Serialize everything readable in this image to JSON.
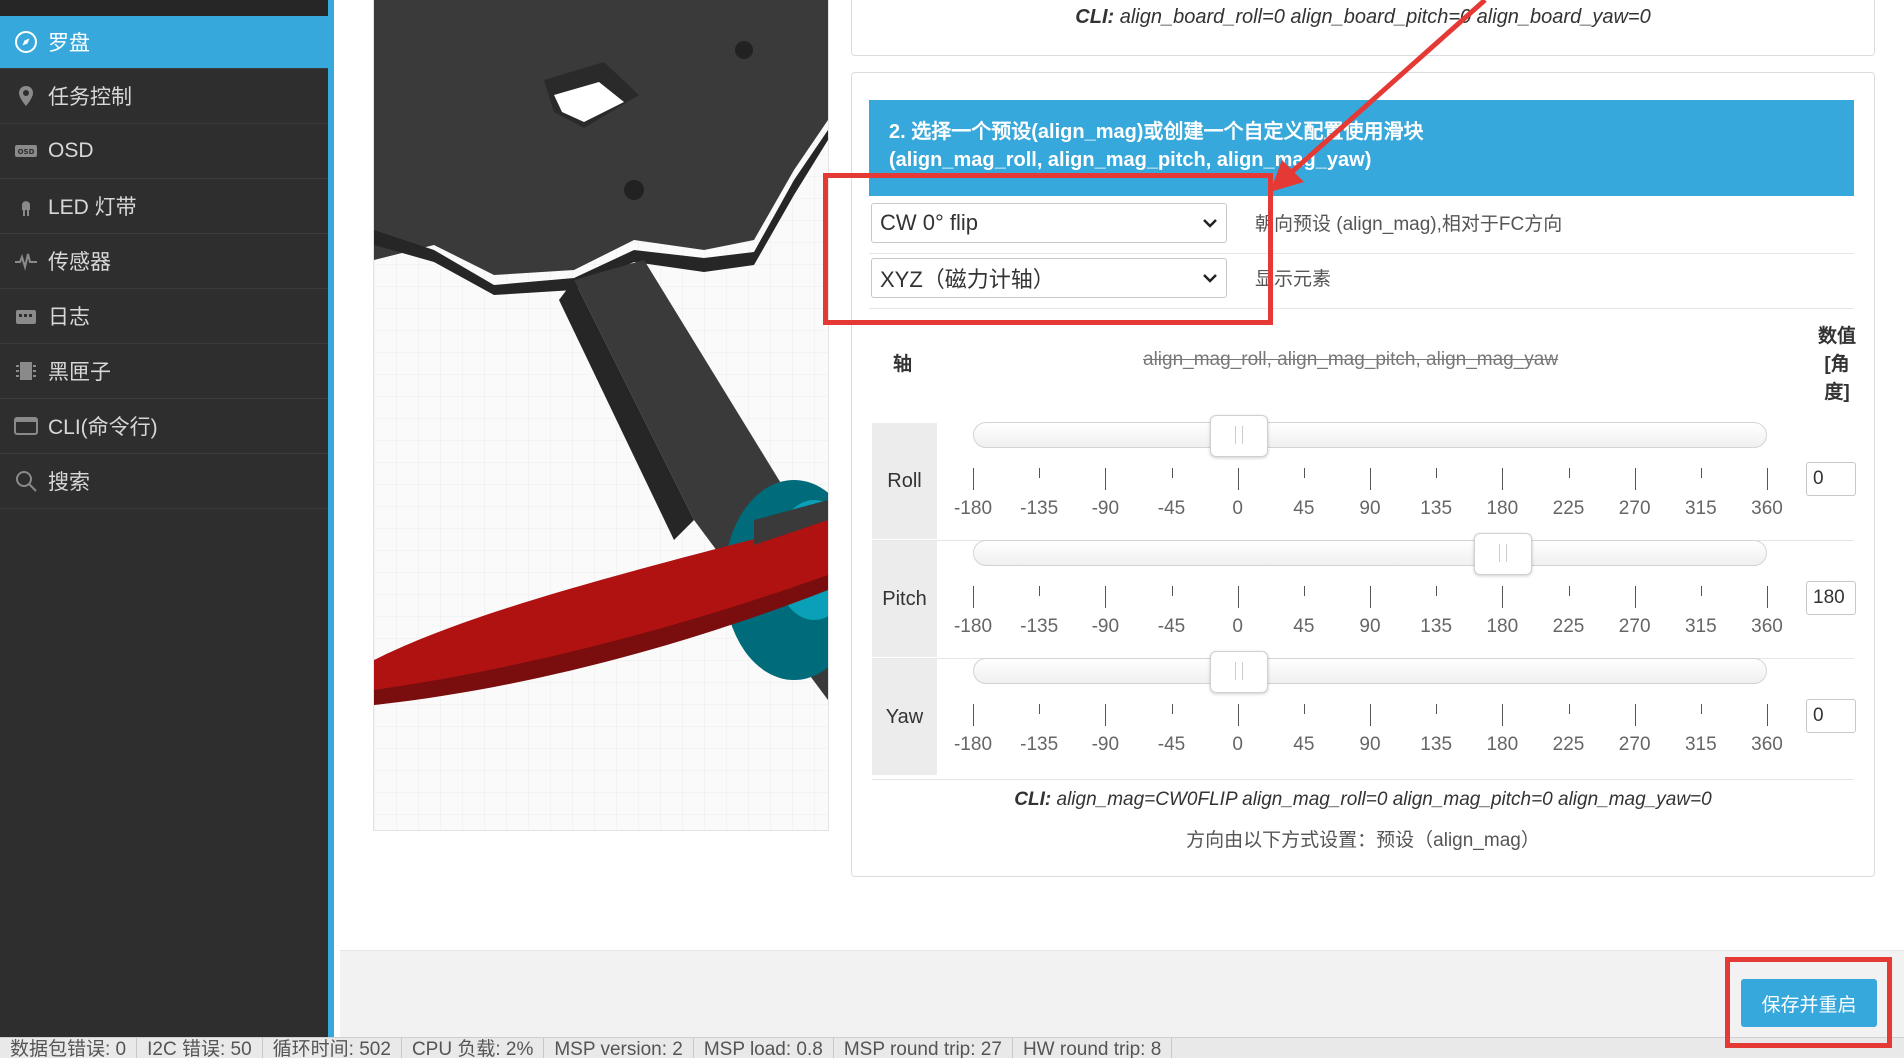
{
  "sidebar": {
    "items": [
      {
        "label": "罗盘",
        "icon": "compass-icon",
        "active": true
      },
      {
        "label": "任务控制",
        "icon": "map-pin-icon"
      },
      {
        "label": "OSD",
        "icon": "osd-icon"
      },
      {
        "label": "LED 灯带",
        "icon": "led-icon"
      },
      {
        "label": "传感器",
        "icon": "sensor-wave-icon"
      },
      {
        "label": "日志",
        "icon": "log-icon"
      },
      {
        "label": "黑匣子",
        "icon": "blackbox-icon"
      },
      {
        "label": "CLI(命令行)",
        "icon": "terminal-icon"
      },
      {
        "label": "搜索",
        "icon": "search-icon"
      }
    ]
  },
  "board": {
    "cli_prefix": "CLI:",
    "cli_text": "align_board_roll=0 align_board_pitch=0 align_board_yaw=0"
  },
  "mag": {
    "header_line1": "2. 选择一个预设(align_mag)或创建一个自定义配置使用滑块",
    "header_line2": "(align_mag_roll, align_mag_pitch, align_mag_yaw)",
    "preset_value": "CW 0° flip",
    "preset_label": "朝向预设 (align_mag),相对于FC方向",
    "display_value": "XYZ（磁力计轴）",
    "display_label": "显示元素",
    "axis_header": "轴",
    "params_header": "align_mag_roll, align_mag_pitch, align_mag_yaw",
    "value_header_1": "数值",
    "value_header_2": "[角",
    "value_header_3": "度]",
    "ticks": [
      "-180",
      "-135",
      "-90",
      "-45",
      "0",
      "45",
      "90",
      "135",
      "180",
      "225",
      "270",
      "315",
      "360"
    ],
    "axes": [
      {
        "name": "Roll",
        "value": "0",
        "level": 0
      },
      {
        "name": "Pitch",
        "value": "180",
        "level": 180
      },
      {
        "name": "Yaw",
        "value": "0",
        "level": 0
      }
    ],
    "slider_min": -180,
    "slider_max": 360,
    "cli_prefix": "CLI:",
    "cli_text": "align_mag=CW0FLIP align_mag_roll=0 align_mag_pitch=0 align_mag_yaw=0",
    "note": "方向由以下方式设置：预设（align_mag）"
  },
  "save_button": "保存并重启",
  "status_bar": [
    "数据包错误: 0",
    "I2C 错误: 50",
    "循环时间: 502",
    "CPU 负载: 2%",
    "MSP version: 2",
    "MSP load: 0.8",
    "MSP round trip: 27",
    "HW round trip: 8"
  ],
  "colors": {
    "accent": "#37a8db",
    "sidebar": "#2e2e2e",
    "annotation": "#e53935"
  }
}
